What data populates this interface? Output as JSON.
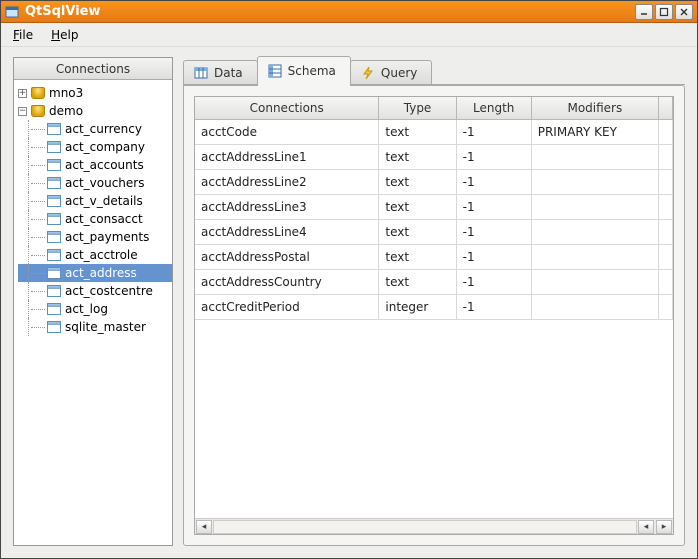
{
  "window": {
    "title": "QtSqlView"
  },
  "menu": {
    "file": "File",
    "help": "Help"
  },
  "sidebar": {
    "header": "Connections",
    "nodes": [
      {
        "label": "mno3",
        "type": "db",
        "expanded": false,
        "depth": 0
      },
      {
        "label": "demo",
        "type": "db",
        "expanded": true,
        "depth": 0
      },
      {
        "label": "act_currency",
        "type": "table",
        "depth": 1
      },
      {
        "label": "act_company",
        "type": "table",
        "depth": 1
      },
      {
        "label": "act_accounts",
        "type": "table",
        "depth": 1
      },
      {
        "label": "act_vouchers",
        "type": "table",
        "depth": 1
      },
      {
        "label": "act_v_details",
        "type": "table",
        "depth": 1
      },
      {
        "label": "act_consacct",
        "type": "table",
        "depth": 1
      },
      {
        "label": "act_payments",
        "type": "table",
        "depth": 1
      },
      {
        "label": "act_acctrole",
        "type": "table",
        "depth": 1
      },
      {
        "label": "act_address",
        "type": "table",
        "depth": 1,
        "selected": true
      },
      {
        "label": "act_costcentre",
        "type": "table",
        "depth": 1
      },
      {
        "label": "act_log",
        "type": "table",
        "depth": 1
      },
      {
        "label": "sqlite_master",
        "type": "table",
        "depth": 1
      }
    ]
  },
  "tabs": {
    "data": {
      "label": "Data"
    },
    "schema": {
      "label": "Schema"
    },
    "query": {
      "label": "Query"
    },
    "active": "schema"
  },
  "schema_table": {
    "columns": [
      "Connections",
      "Type",
      "Length",
      "Modifiers"
    ],
    "rows": [
      {
        "c0": "acctCode",
        "c1": "text",
        "c2": "-1",
        "c3": "PRIMARY KEY"
      },
      {
        "c0": "acctAddressLine1",
        "c1": "text",
        "c2": "-1",
        "c3": ""
      },
      {
        "c0": "acctAddressLine2",
        "c1": "text",
        "c2": "-1",
        "c3": ""
      },
      {
        "c0": "acctAddressLine3",
        "c1": "text",
        "c2": "-1",
        "c3": ""
      },
      {
        "c0": "acctAddressLine4",
        "c1": "text",
        "c2": "-1",
        "c3": ""
      },
      {
        "c0": "acctAddressPostal",
        "c1": "text",
        "c2": "-1",
        "c3": ""
      },
      {
        "c0": "acctAddressCountry",
        "c1": "text",
        "c2": "-1",
        "c3": ""
      },
      {
        "c0": "acctCreditPeriod",
        "c1": "integer",
        "c2": "-1",
        "c3": ""
      }
    ]
  }
}
